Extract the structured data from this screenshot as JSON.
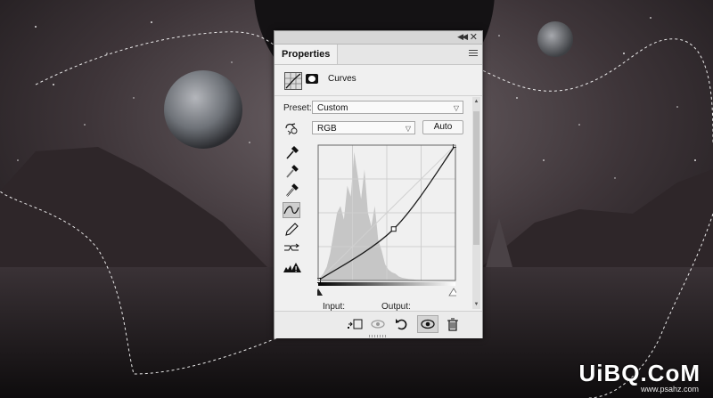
{
  "panel": {
    "tab_label": "Properties",
    "header_title": "Curves",
    "preset_label": "Preset:",
    "preset_value": "Custom",
    "channel_value": "RGB",
    "auto_label": "Auto",
    "input_label": "Input:",
    "output_label": "Output:"
  },
  "curve": {
    "points": [
      [
        0,
        0
      ],
      [
        0.55,
        0.38
      ],
      [
        1,
        1
      ]
    ]
  },
  "watermark": {
    "logo_text": "UiBQ.CoM",
    "url": "www.psahz.com"
  },
  "icons": {
    "tools": [
      "on-image-adjust-icon",
      "eyedropper-black-icon",
      "eyedropper-gray-icon",
      "eyedropper-white-icon",
      "curve-point-icon",
      "pencil-icon",
      "smooth-icon",
      "clipping-warning-icon"
    ],
    "bottom": [
      "clip-to-layer-icon",
      "view-previous-icon",
      "reset-icon",
      "visibility-icon",
      "delete-icon"
    ]
  },
  "colors": {
    "panel_bg": "#f0f0f0",
    "histogram": "#c6c6c6"
  }
}
